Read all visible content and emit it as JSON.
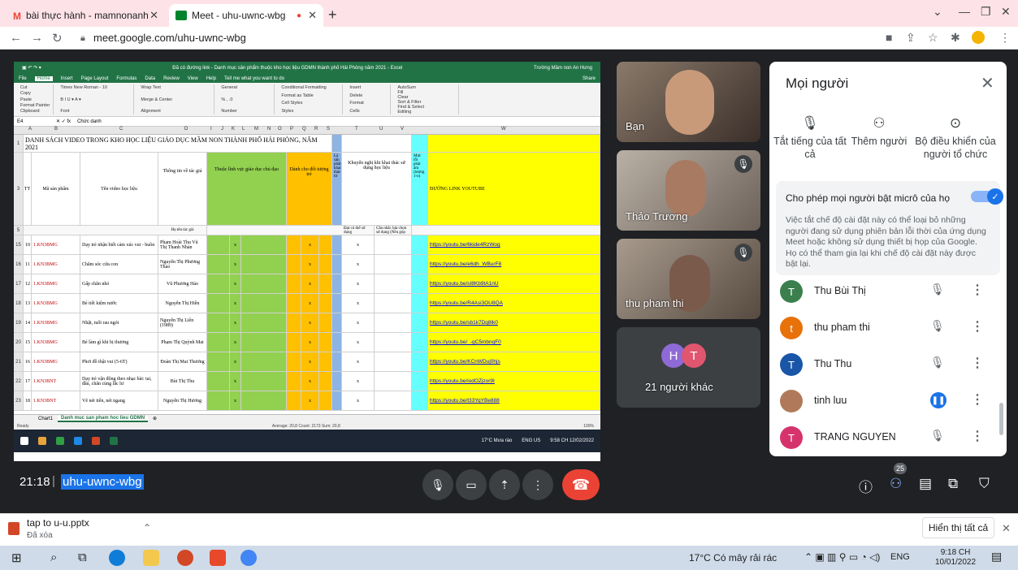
{
  "browser": {
    "tabs": [
      {
        "title": "bài thực hành - mamnonanhung!",
        "active": false
      },
      {
        "title": "Meet - uhu-uwnc-wbg",
        "active": true
      }
    ],
    "url": "meet.google.com/uhu-uwnc-wbg"
  },
  "excel": {
    "title": "Đã có đường link - Danh mục sản phẩm thuộc kho học liệu GDMN thành phố Hải Phòng năm 2021 - Excel",
    "user": "Trường Mầm non An Hưng",
    "menu": [
      "File",
      "Home",
      "Insert",
      "Page Layout",
      "Formulas",
      "Data",
      "Review",
      "View",
      "Help",
      "Tell me what you want to do"
    ],
    "share": "Share",
    "ribbon": {
      "cut": "Cut",
      "copy": "Copy",
      "paste": "Paste",
      "format_painter": "Format Painter",
      "clipboard": "Clipboard",
      "font_name": "Times New Roman",
      "font_size": "10",
      "font": "Font",
      "wrap": "Wrap Text",
      "merge": "Merge & Center",
      "alignment": "Alignment",
      "general": "General",
      "number": "Number",
      "conditional": "Conditional Formatting",
      "format_table": "Format as Table",
      "cell_styles": "Cell Styles",
      "styles": "Styles",
      "insert": "Insert",
      "delete": "Delete",
      "format": "Format",
      "cells": "Cells",
      "autosum": "AutoSum",
      "fill": "Fill",
      "clear": "Clear",
      "sort": "Sort & Filter",
      "find": "Find & Select",
      "editing": "Editing"
    },
    "namebox": "E4",
    "formula": "Chức danh",
    "cols": [
      "A",
      "B",
      "C",
      "D",
      "I",
      "J",
      "K",
      "L",
      "M",
      "N",
      "O",
      "P",
      "Q",
      "R",
      "S",
      "T",
      "U",
      "V",
      "W"
    ],
    "heading": "DANH SÁCH VIDEO TRONG KHO HỌC LIỆU GIÁO DỤC MẦM NON THÀNH PHỐ HẢI PHÒNG, NĂM 2021",
    "hdr": {
      "tt": "TT",
      "ma": "Mã sản phẩm",
      "ten": "Tên video học liệu",
      "tg": "Thông tin về tác giả",
      "hoten": "Họ tên tác giả",
      "linhvuc": "Thuộc lĩnh vực giáo dục chủ đạo",
      "danhcho": "Dành cho đối tượng trẻ",
      "lasp": "Là sản phẩm khai thác từ",
      "khuyen": "Khuyến nghị khi khai thác sử dụng học liệu",
      "dat": "Đạt có thể sử dụng",
      "can": "Cần nhắc lựa chọn sử dụng (Nêu góp",
      "muc": "Mức lỗi phát âm (tượng 1-n)",
      "link": "ĐƯỜNG LINK YOUTUBE"
    },
    "rows": [
      {
        "rn": "15",
        "tt": "10",
        "ma": "1.KN3BMG",
        "ten": "Dạy trẻ nhận biết cảm xúc vui - buồn",
        "tg": "Phạm Hoài Thu Vũ Thị Thanh Nhàn",
        "x1": "x",
        "x2": "x",
        "x3": "x",
        "link": "https://youtu.be/6kide4RzWog"
      },
      {
        "rn": "16",
        "tt": "11",
        "ma": "1.KN3BMG",
        "ten": "Chăm sóc cửa con",
        "tg": "Nguyễn Thị Phương Thảo",
        "x1": "x",
        "x2": "x",
        "x3": "x",
        "link": "https://youtu.be/e6dh_WBurF8"
      },
      {
        "rn": "17",
        "tt": "12",
        "ma": "1.KN3BMG",
        "ten": "Gấp chăn nhỏ",
        "tg": "Vũ Phương Hảo",
        "x1": "x",
        "x2": "x",
        "x3": "x",
        "link": "https://youtu.be/sI8Kb9tA1nU"
      },
      {
        "rn": "18",
        "tt": "13",
        "ma": "1.KN3BMG",
        "ten": "Bé tiết kiệm nước",
        "tg": "Nguyễn Thị Hiền",
        "x1": "x",
        "x2": "x",
        "x3": "x",
        "link": "https://youtu.be/R4Asi3OU8QA"
      },
      {
        "rn": "19",
        "tt": "14",
        "ma": "1.KN3BMG",
        "ten": "Nhặt, tuốt rau ngót",
        "tg": "Nguyễn Thị Liên (1989)",
        "x1": "x",
        "x2": "x",
        "x3": "x",
        "link": "https://youtu.be/sb1k7Dq8lk0"
      },
      {
        "rn": "20",
        "tt": "15",
        "ma": "1.KN3BMG",
        "ten": "Bé làm gì khi bị thương",
        "tg": "Phạm Thị Quỳnh Mai",
        "x1": "x",
        "x2": "x",
        "x3": "x",
        "link": "https://youtu.be/_-gC5mbnqF0"
      },
      {
        "rn": "21",
        "tt": "16",
        "ma": "1.KN3BMG",
        "ten": "Phơi đồ thật vui (5-6T)",
        "tg": "Đoàn Thị Mai Thương",
        "x1": "x",
        "x2": "x",
        "x3": "x",
        "link": "https://youtu.be/KCnWDuj0hjs"
      },
      {
        "rn": "22",
        "tt": "17",
        "ma": "1.KN3BNT",
        "ten": "Dạy trẻ vận động theo nhạc bài: tai, đầu, chân cùng lắc lư",
        "tg": "Bùi Thị Thu",
        "x1": "x",
        "x2": "x",
        "x3": "x",
        "link": "https://youtu.be/iodOZjzor9I"
      },
      {
        "rn": "23",
        "tt": "18",
        "ma": "1.KN3BNT",
        "ten": "Vẽ nét tiến, nét ngang",
        "tg": "Nguyễn Thị Hương",
        "x1": "x",
        "x2": "x",
        "x3": "x",
        "link": "https://youtu.be/t33YqYBe888"
      }
    ],
    "sheets": [
      "Chart1",
      "Danh muc san pham hoc lieu GDMN"
    ],
    "status": {
      "ready": "Ready",
      "agg": "Average: 20,8   Count: 2173   Sum: 20,8",
      "zoom": "100%"
    },
    "taskbar": {
      "weather": "17°C Mưa rào",
      "lang": "ENG US",
      "time": "9:58 CH",
      "date": "12/02/2022"
    }
  },
  "tiles": [
    {
      "name": "Bạn"
    },
    {
      "name": "Thảo Trương"
    },
    {
      "name": "thu pham thi"
    },
    {
      "name": "21 người khác",
      "initials": [
        "H",
        "T"
      ]
    }
  ],
  "panel": {
    "title": "Mọi người",
    "actions": [
      {
        "label": "Tắt tiếng của tất cả"
      },
      {
        "label": "Thêm người"
      },
      {
        "label": "Bộ điều khiển của người tổ chức"
      }
    ],
    "allow_heading": "Cho phép mọi người bật micrô của họ",
    "allow_text": "Việc tắt chế độ cài đặt này có thể loại bỏ những người đang sử dụng phiên bản lỗi thời của ứng dụng Meet hoặc không sử dụng thiết bị họp của Google. Họ có thể tham gia lại khi chế độ cài đặt này được bật lại.",
    "people": [
      {
        "name": "Thu Bùi Thị",
        "initial": "T",
        "color": "#3c7f4e"
      },
      {
        "name": "thu pham thi",
        "initial": "t",
        "color": "#e8710a"
      },
      {
        "name": "Thu Thu",
        "initial": "T",
        "color": "#1a56a8"
      },
      {
        "name": "tinh luu",
        "initial": "",
        "color": "#b07a5a"
      },
      {
        "name": "TRANG NGUYEN",
        "initial": "T",
        "color": "#d6336c"
      }
    ]
  },
  "meeting": {
    "time": "21:18",
    "code": "uhu-uwnc-wbg",
    "participants": "25"
  },
  "download": {
    "file": "tap to u-u.pptx",
    "status": "Đã xóa",
    "show_all": "Hiển thị tất cả"
  },
  "taskbar": {
    "weather": "17°C Có mây rải rác",
    "lang": "ENG",
    "time": "9:18 CH",
    "date": "10/01/2022"
  }
}
